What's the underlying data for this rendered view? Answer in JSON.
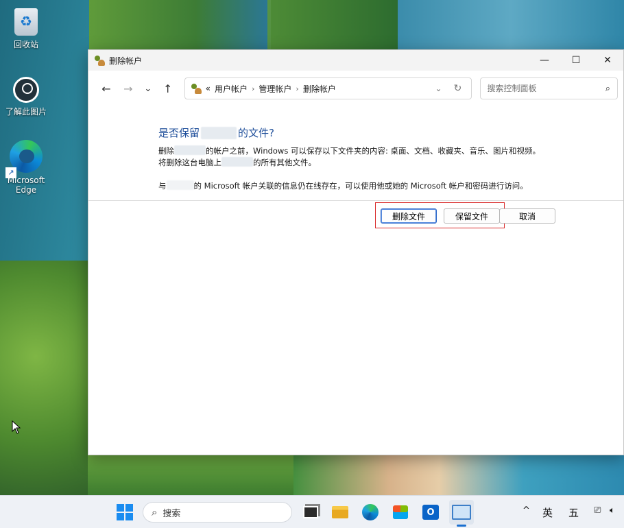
{
  "desktop": {
    "icons": [
      {
        "label": "回收站",
        "icon": "recycle-bin-icon"
      },
      {
        "label": "了解此图片",
        "icon": "learn-picture-icon"
      },
      {
        "label": "Microsoft Edge",
        "icon": "edge-icon"
      }
    ]
  },
  "window": {
    "title": "删除帐户",
    "controls": {
      "minimize": "—",
      "maximize": "☐",
      "close": "✕"
    },
    "nav": {
      "back": "←",
      "forward": "→",
      "recent": "⌄",
      "up": "↑",
      "breadcrumb_prefix": "«",
      "breadcrumb": [
        "用户帐户",
        "管理帐户",
        "删除帐户"
      ],
      "separator": "›",
      "dropdown": "⌄",
      "refresh": "↻"
    },
    "search": {
      "placeholder": "搜索控制面板",
      "icon": "search-icon"
    },
    "dialog": {
      "heading_before": "是否保留",
      "heading_after": "的文件?",
      "p1_before": "删除",
      "p1_after": "的帐户之前，Windows 可以保存以下文件夹的内容: 桌面、文档、收藏夹、音乐、图片和视频。",
      "p2_before": "将删除这台电脑上",
      "p2_after": "的所有其他文件。",
      "p3_before": "与",
      "p3_after": "的 Microsoft 帐户关联的信息仍在线存在，可以使用他或她的 Microsoft 帐户和密码进行访问。",
      "buttons": {
        "delete": "删除文件",
        "keep": "保留文件",
        "cancel": "取消"
      }
    }
  },
  "taskbar": {
    "search_label": "搜索",
    "apps": [
      "task-view",
      "file-explorer",
      "edge",
      "microsoft-store",
      "outlook",
      "control-panel"
    ],
    "tray": {
      "overflow": "^",
      "ime_lang": "英",
      "ime_mode": "五"
    }
  },
  "colors": {
    "heading": "#1e4e9a",
    "highlight_box": "#d92a2a",
    "accent": "#1a6fd0"
  }
}
